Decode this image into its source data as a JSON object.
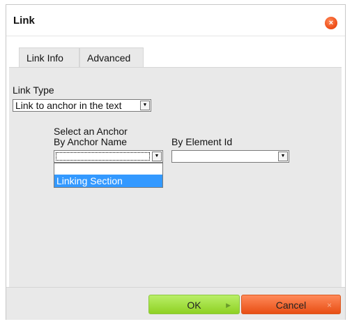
{
  "dialog": {
    "title": "Link",
    "close_symbol": "×"
  },
  "tabs": [
    {
      "label": "Link Info",
      "active": true
    },
    {
      "label": "Advanced",
      "active": false
    }
  ],
  "form": {
    "link_type_label": "Link Type",
    "link_type_value": "Link to anchor in the text",
    "select_anchor_label": "Select an Anchor",
    "by_anchor_name_label": "By Anchor Name",
    "by_element_id_label": "By Element Id",
    "anchor_name_value": "",
    "element_id_value": "",
    "anchor_options": [
      "",
      "Linking Section"
    ],
    "highlighted_option": "Linking Section"
  },
  "footer": {
    "ok_label": "OK",
    "ok_symbol": "▶",
    "cancel_label": "Cancel",
    "cancel_symbol": "×"
  },
  "colors": {
    "ok_green": "#8fd123",
    "cancel_orange": "#e84e14",
    "highlight_blue": "#3399ff",
    "close_orange": "#f0521c"
  },
  "icons": [
    "close-icon",
    "dropdown-arrow-icon",
    "ok-arrow-icon",
    "cancel-x-icon"
  ]
}
